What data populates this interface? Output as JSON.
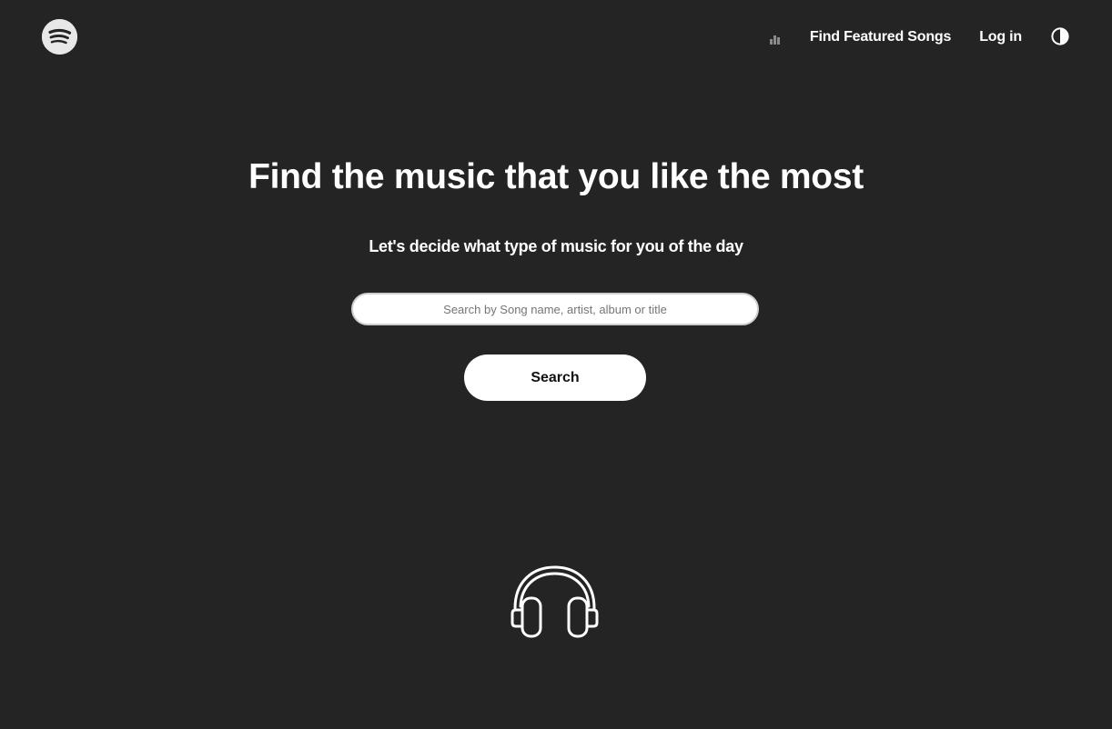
{
  "header": {
    "logo_icon": "spotify-logo-icon",
    "stats_icon": "bar-chart-icon",
    "featured_label": "Find Featured Songs",
    "login_label": "Log in",
    "theme_icon": "contrast-toggle-icon"
  },
  "hero": {
    "title": "Find the music that you like the most",
    "subtitle": "Let's decide what type of music for you of the day"
  },
  "search": {
    "value": "",
    "placeholder": "Search by Song name, artist, album or title",
    "button_label": "Search"
  },
  "illustration": {
    "icon": "headphones-icon"
  },
  "colors": {
    "background": "#242424",
    "text": "#ffffff",
    "button_bg": "#ffffff",
    "button_text": "#111111"
  }
}
